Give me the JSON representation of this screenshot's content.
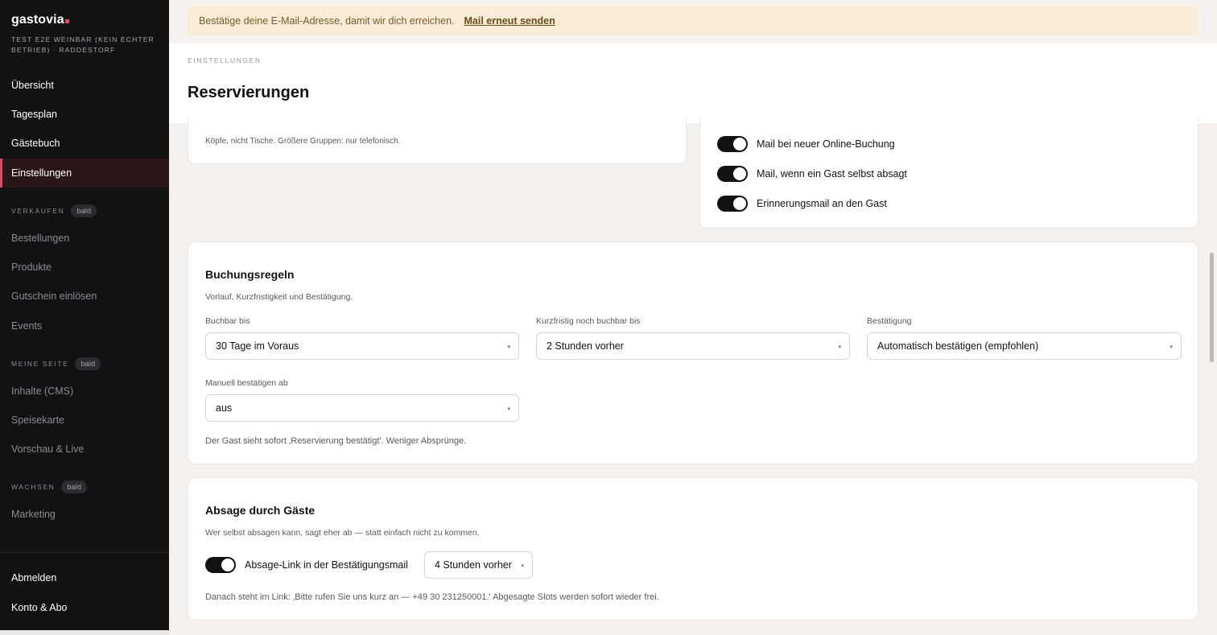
{
  "sidebar": {
    "brand": "gastovia",
    "venue": "TEST E2E WEINBAR (KEIN ECHTER BETRIEB) · RADDESTORF",
    "main_items": [
      {
        "label": "Übersicht"
      },
      {
        "label": "Tagesplan"
      },
      {
        "label": "Gästebuch"
      },
      {
        "label": "Einstellungen"
      }
    ],
    "sections": [
      {
        "title": "VERKAUFEN",
        "badge": "bald",
        "items": [
          {
            "label": "Bestellungen"
          },
          {
            "label": "Produkte"
          },
          {
            "label": "Gutschein einlösen"
          },
          {
            "label": "Events"
          }
        ]
      },
      {
        "title": "MEINE SEITE",
        "badge": "bald",
        "items": [
          {
            "label": "Inhalte (CMS)"
          },
          {
            "label": "Speisekarte"
          },
          {
            "label": "Vorschau & Live"
          }
        ]
      },
      {
        "title": "WACHSEN",
        "badge": "bald",
        "items": [
          {
            "label": "Marketing"
          }
        ]
      }
    ],
    "footer_items": [
      {
        "label": "Abmelden"
      },
      {
        "label": "Konto & Abo"
      }
    ]
  },
  "banner": {
    "text": "Bestätige deine E-Mail-Adresse, damit wir dich erreichen.",
    "link": "Mail erneut senden"
  },
  "header": {
    "eyebrow": "EINSTELLUNGEN",
    "title": "Reservierungen"
  },
  "capacity_card": {
    "note": "Köpfe, nicht Tische. Größere Gruppen: nur telefonisch."
  },
  "notifications_card": {
    "toggles": [
      {
        "label": "Mail bei neuer Online-Buchung",
        "on": true
      },
      {
        "label": "Mail, wenn ein Gast selbst absagt",
        "on": true
      },
      {
        "label": "Erinnerungsmail an den Gast",
        "on": true
      }
    ]
  },
  "booking_rules": {
    "title": "Buchungsregeln",
    "subtitle": "Vorlauf, Kurzfristigkeit und Bestätigung.",
    "fields": [
      {
        "label": "Buchbar bis",
        "value": "30 Tage im Voraus"
      },
      {
        "label": "Kurzfristig noch buchbar bis",
        "value": "2 Stunden vorher"
      },
      {
        "label": "Bestätigung",
        "value": "Automatisch bestätigen (empfohlen)"
      },
      {
        "label": "Manuell bestätigen ab",
        "value": "aus"
      }
    ],
    "hint": "Der Gast sieht sofort ‚Reservierung bestätigt'. Weniger Absprünge."
  },
  "cancellation": {
    "title": "Absage durch Gäste",
    "subtitle": "Wer selbst absagen kann, sagt eher ab — statt einfach nicht zu kommen.",
    "toggle_label": "Absage-Link in der Bestätigungsmail",
    "toggle_on": true,
    "select_value": "4 Stunden vorher",
    "hint": "Danach steht im Link: ‚Bitte rufen Sie uns kurz an — +49 30 231250001.' Abgesagte Slots werden sofort wieder frei."
  }
}
